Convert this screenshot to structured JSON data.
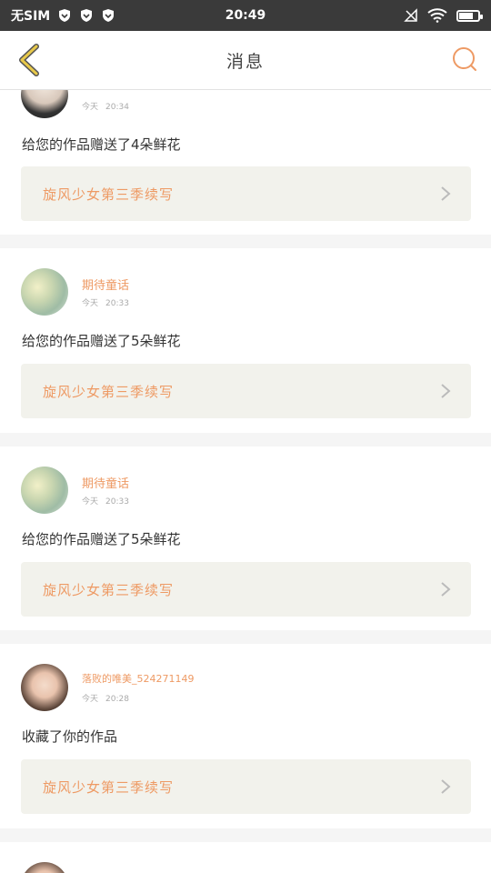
{
  "status_bar": {
    "carrier": "无SIM",
    "time": "20:49",
    "battery_level": 0.7
  },
  "header": {
    "title": "消息"
  },
  "notifications": [
    {
      "username": "",
      "date": "今天",
      "time": "20:34",
      "message": "给您的作品赠送了4朵鲜花",
      "work_title": "旋风少女第三季续写"
    },
    {
      "username": "期待童话",
      "date": "今天",
      "time": "20:33",
      "message": "给您的作品赠送了5朵鲜花",
      "work_title": "旋风少女第三季续写"
    },
    {
      "username": "期待童话",
      "date": "今天",
      "time": "20:33",
      "message": "给您的作品赠送了5朵鲜花",
      "work_title": "旋风少女第三季续写"
    },
    {
      "username": "落败的唯美_524271149",
      "date": "今天",
      "time": "20:28",
      "message": "收藏了你的作品",
      "work_title": "旋风少女第三季续写"
    }
  ],
  "colors": {
    "accent": "#ee9a64",
    "back_arrow": "#e8c94a",
    "status_bar_bg": "#3a3a3a"
  }
}
